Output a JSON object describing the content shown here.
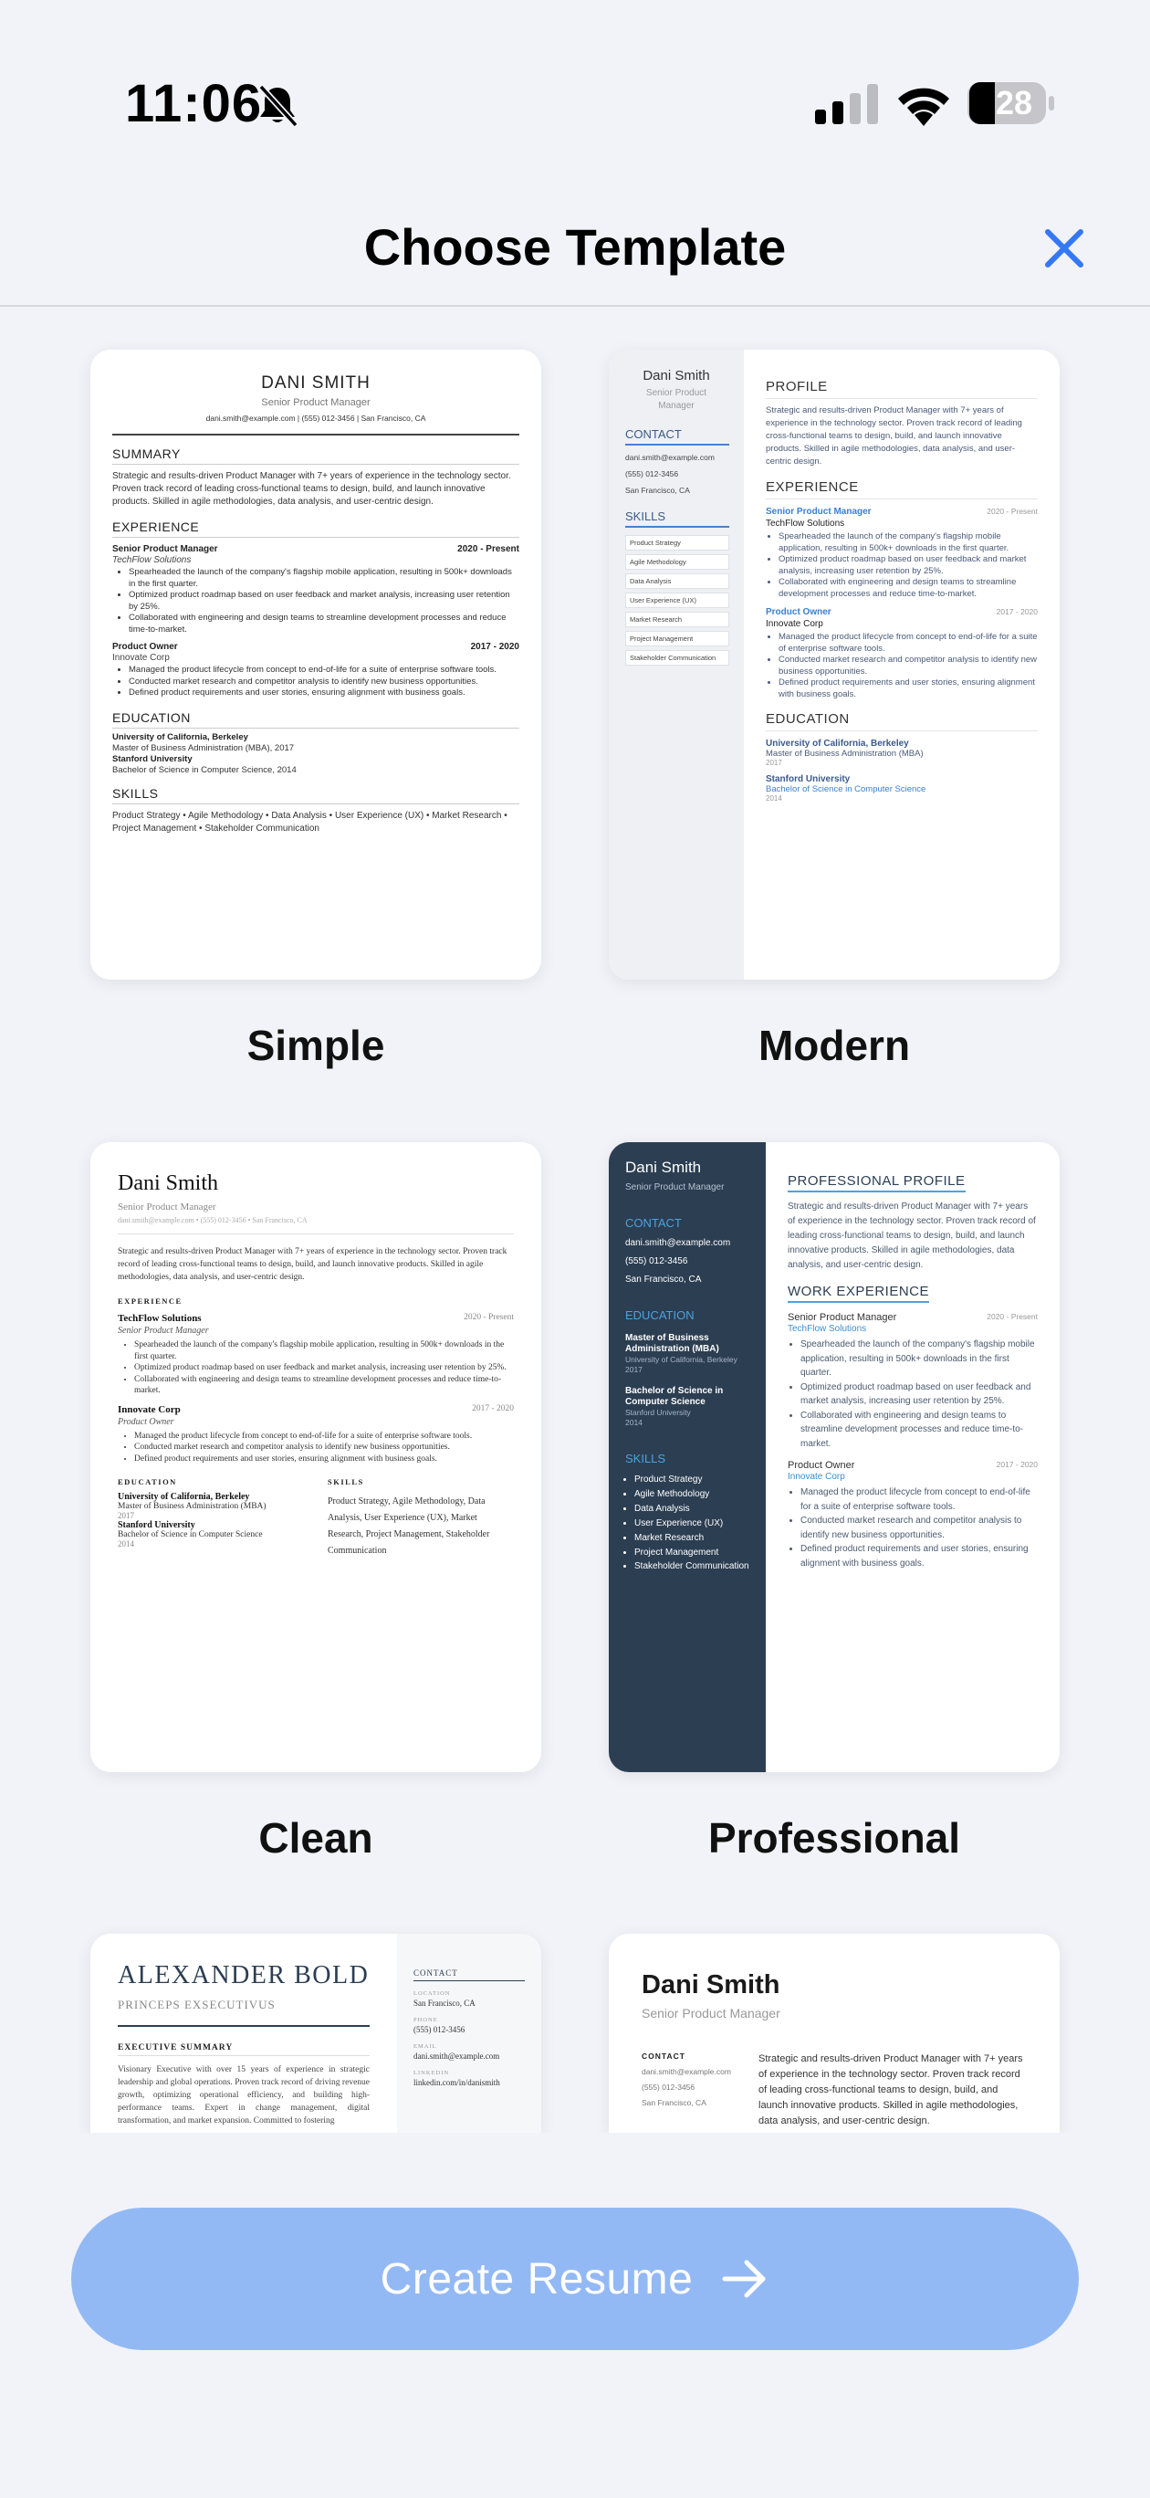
{
  "status_bar": {
    "time": "11:06",
    "battery": "28",
    "icons": [
      "bell-slash-icon",
      "cellular-signal-icon",
      "wifi-icon",
      "battery-icon"
    ]
  },
  "header": {
    "title": "Choose Template",
    "close_icon": "close-icon",
    "accent": "#3478f6"
  },
  "templates": [
    {
      "label": "Simple",
      "preview": {
        "name": "DANI SMITH",
        "role": "Senior Product Manager",
        "contact": "dani.smith@example.com | (555) 012-3456 | San Francisco, CA",
        "summary_heading": "SUMMARY",
        "summary": "Strategic and results-driven Product Manager with 7+ years of experience in the technology sector. Proven track record of leading cross-functional teams to design, build, and launch innovative products. Skilled in agile methodologies, data analysis, and user-centric design.",
        "experience_heading": "EXPERIENCE",
        "jobs": [
          {
            "title": "Senior Product Manager",
            "dates": "2020 - Present",
            "company": "TechFlow Solutions",
            "bullets": [
              "Spearheaded the launch of the company's flagship mobile application, resulting in 500k+ downloads in the first quarter.",
              "Optimized product roadmap based on user feedback and market analysis, increasing user retention by 25%.",
              "Collaborated with engineering and design teams to streamline development processes and reduce time-to-market."
            ]
          },
          {
            "title": "Product Owner",
            "dates": "2017 - 2020",
            "company": "Innovate Corp",
            "bullets": [
              "Managed the product lifecycle from concept to end-of-life for a suite of enterprise software tools.",
              "Conducted market research and competitor analysis to identify new business opportunities.",
              "Defined product requirements and user stories, ensuring alignment with business goals."
            ]
          }
        ],
        "education_heading": "EDUCATION",
        "education": [
          {
            "school": "University of California, Berkeley",
            "degree": "Master of Business Administration (MBA), 2017"
          },
          {
            "school": "Stanford University",
            "degree": "Bachelor of Science in Computer Science, 2014"
          }
        ],
        "skills_heading": "SKILLS",
        "skills": "Product Strategy • Agile Methodology • Data Analysis • User Experience (UX) • Market Research • Project Management • Stakeholder Communication"
      }
    },
    {
      "label": "Modern",
      "preview": {
        "name": "Dani Smith",
        "role": "Senior Product Manager",
        "contact_heading": "CONTACT",
        "contact": [
          "dani.smith@example.com",
          "(555) 012-3456",
          "San Francisco, CA"
        ],
        "skills_heading": "SKILLS",
        "skills": [
          "Product Strategy",
          "Agile Methodology",
          "Data Analysis",
          "User Experience (UX)",
          "Market Research",
          "Project Management",
          "Stakeholder Communication"
        ],
        "profile_heading": "PROFILE",
        "profile": "Strategic and results-driven Product Manager with 7+ years of experience in the technology sector. Proven track record of leading cross-functional teams to design, build, and launch innovative products. Skilled in agile methodologies, data analysis, and user-centric design.",
        "experience_heading": "EXPERIENCE",
        "jobs": [
          {
            "title": "Senior Product Manager",
            "dates": "2020 - Present",
            "company": "TechFlow Solutions",
            "bullets": [
              "Spearheaded the launch of the company's flagship mobile application, resulting in 500k+ downloads in the first quarter.",
              "Optimized product roadmap based on user feedback and market analysis, increasing user retention by 25%.",
              "Collaborated with engineering and design teams to streamline development processes and reduce time-to-market."
            ]
          },
          {
            "title": "Product Owner",
            "dates": "2017 - 2020",
            "company": "Innovate Corp",
            "bullets": [
              "Managed the product lifecycle from concept to end-of-life for a suite of enterprise software tools.",
              "Conducted market research and competitor analysis to identify new business opportunities.",
              "Defined product requirements and user stories, ensuring alignment with business goals."
            ]
          }
        ],
        "education_heading": "EDUCATION",
        "education": [
          {
            "school": "University of California, Berkeley",
            "degree": "Master of Business Administration (MBA)",
            "year": "2017"
          },
          {
            "school": "Stanford University",
            "degree": "Bachelor of Science in Computer Science",
            "year": "2014"
          }
        ]
      }
    },
    {
      "label": "Clean",
      "preview": {
        "name": "Dani Smith",
        "role": "Senior Product Manager",
        "contact": "dani.smith@example.com • (555) 012-3456 • San Francisco, CA",
        "summary": "Strategic and results-driven Product Manager with 7+ years of experience in the technology sector. Proven track record of leading cross-functional teams to design, build, and launch innovative products. Skilled in agile methodologies, data analysis, and user-centric design.",
        "experience_heading": "EXPERIENCE",
        "jobs": [
          {
            "company": "TechFlow Solutions",
            "dates": "2020 - Present",
            "title": "Senior Product Manager",
            "bullets": [
              "Spearheaded the launch of the company's flagship mobile application, resulting in 500k+ downloads in the first quarter.",
              "Optimized product roadmap based on user feedback and market analysis, increasing user retention by 25%.",
              "Collaborated with engineering and design teams to streamline development processes and reduce time-to-market."
            ]
          },
          {
            "company": "Innovate Corp",
            "dates": "2017 - 2020",
            "title": "Product Owner",
            "bullets": [
              "Managed the product lifecycle from concept to end-of-life for a suite of enterprise software tools.",
              "Conducted market research and competitor analysis to identify new business opportunities.",
              "Defined product requirements and user stories, ensuring alignment with business goals."
            ]
          }
        ],
        "education_heading": "EDUCATION",
        "education": [
          {
            "school": "University of California, Berkeley",
            "degree": "Master of Business Administration (MBA)",
            "year": "2017"
          },
          {
            "school": "Stanford University",
            "degree": "Bachelor of Science in Computer Science",
            "year": "2014"
          }
        ],
        "skills_heading": "SKILLS",
        "skills": "Product Strategy, Agile Methodology, Data Analysis, User Experience (UX), Market Research, Project Management, Stakeholder Communication"
      }
    },
    {
      "label": "Professional",
      "preview": {
        "name": "Dani Smith",
        "role": "Senior Product Manager",
        "contact_heading": "CONTACT",
        "contact": [
          "dani.smith@example.com",
          "(555) 012-3456",
          "San Francisco, CA"
        ],
        "education_heading": "EDUCATION",
        "education": [
          {
            "degree": "Master of Business Administration (MBA)",
            "school": "University of California, Berkeley",
            "year": "2017"
          },
          {
            "degree": "Bachelor of Science in Computer Science",
            "school": "Stanford University",
            "year": "2014"
          }
        ],
        "skills_heading": "SKILLS",
        "skills": [
          "Product Strategy",
          "Agile Methodology",
          "Data Analysis",
          "User Experience (UX)",
          "Market Research",
          "Project Management",
          "Stakeholder Communication"
        ],
        "profile_heading": "PROFESSIONAL PROFILE",
        "profile": "Strategic and results-driven Product Manager with 7+ years of experience in the technology sector. Proven track record of leading cross-functional teams to design, build, and launch innovative products. Skilled in agile methodologies, data analysis, and user-centric design.",
        "experience_heading": "WORK EXPERIENCE",
        "jobs": [
          {
            "title": "Senior Product Manager",
            "dates": "2020 - Present",
            "company": "TechFlow Solutions",
            "bullets": [
              "Spearheaded the launch of the company's flagship mobile application, resulting in 500k+ downloads in the first quarter.",
              "Optimized product roadmap based on user feedback and market analysis, increasing user retention by 25%.",
              "Collaborated with engineering and design teams to streamline development processes and reduce time-to-market."
            ]
          },
          {
            "title": "Product Owner",
            "dates": "2017 - 2020",
            "company": "Innovate Corp",
            "bullets": [
              "Managed the product lifecycle from concept to end-of-life for a suite of enterprise software tools.",
              "Conducted market research and competitor analysis to identify new business opportunities.",
              "Defined product requirements and user stories, ensuring alignment with business goals."
            ]
          }
        ]
      }
    },
    {
      "preview": {
        "name": "ALEXANDER BOLD",
        "role": "PRINCEPS EXSECUTIVUS",
        "summary_heading": "EXECUTIVE SUMMARY",
        "summary": "Visionary Executive with over 15 years of experience in strategic leadership and global operations. Proven track record of driving revenue growth, optimizing operational efficiency, and building high-performance teams. Expert in change management, digital transformation, and market expansion. Committed to fostering",
        "contact_heading": "CONTACT",
        "contact": [
          {
            "label": "LOCATION",
            "value": "San Francisco, CA"
          },
          {
            "label": "PHONE",
            "value": "(555) 012-3456"
          },
          {
            "label": "EMAIL",
            "value": "dani.smith@example.com"
          },
          {
            "label": "LINKEDIN",
            "value": "linkedin.com/in/danismith"
          }
        ]
      }
    },
    {
      "preview": {
        "name": "Dani Smith",
        "role": "Senior Product Manager",
        "contact_heading": "CONTACT",
        "contact": [
          "dani.smith@example.com",
          "(555) 012-3456",
          "San Francisco, CA"
        ],
        "summary": "Strategic and results-driven Product Manager with 7+ years of experience in the technology sector. Proven track record of leading cross-functional teams to design, build, and launch innovative products. Skilled in agile methodologies, data analysis, and user-centric design."
      }
    }
  ],
  "cta": {
    "label": "Create Resume",
    "icon": "arrow-right-icon",
    "color": "#93b9f5"
  }
}
